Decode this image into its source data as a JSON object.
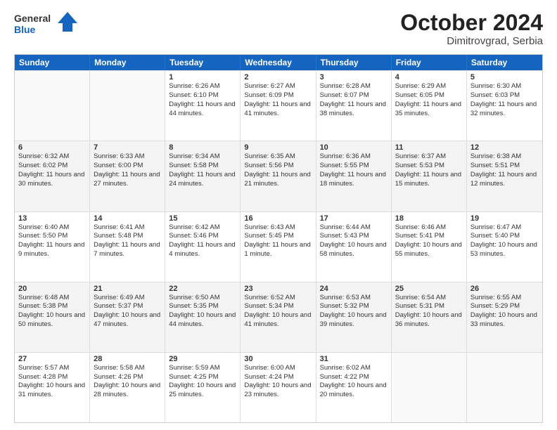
{
  "header": {
    "logo_general": "General",
    "logo_blue": "Blue",
    "month_year": "October 2024",
    "location": "Dimitrovgrad, Serbia"
  },
  "days_of_week": [
    "Sunday",
    "Monday",
    "Tuesday",
    "Wednesday",
    "Thursday",
    "Friday",
    "Saturday"
  ],
  "weeks": [
    [
      {
        "day": "",
        "sunrise": "",
        "sunset": "",
        "daylight": ""
      },
      {
        "day": "",
        "sunrise": "",
        "sunset": "",
        "daylight": ""
      },
      {
        "day": "1",
        "sunrise": "Sunrise: 6:26 AM",
        "sunset": "Sunset: 6:10 PM",
        "daylight": "Daylight: 11 hours and 44 minutes."
      },
      {
        "day": "2",
        "sunrise": "Sunrise: 6:27 AM",
        "sunset": "Sunset: 6:09 PM",
        "daylight": "Daylight: 11 hours and 41 minutes."
      },
      {
        "day": "3",
        "sunrise": "Sunrise: 6:28 AM",
        "sunset": "Sunset: 6:07 PM",
        "daylight": "Daylight: 11 hours and 38 minutes."
      },
      {
        "day": "4",
        "sunrise": "Sunrise: 6:29 AM",
        "sunset": "Sunset: 6:05 PM",
        "daylight": "Daylight: 11 hours and 35 minutes."
      },
      {
        "day": "5",
        "sunrise": "Sunrise: 6:30 AM",
        "sunset": "Sunset: 6:03 PM",
        "daylight": "Daylight: 11 hours and 32 minutes."
      }
    ],
    [
      {
        "day": "6",
        "sunrise": "Sunrise: 6:32 AM",
        "sunset": "Sunset: 6:02 PM",
        "daylight": "Daylight: 11 hours and 30 minutes."
      },
      {
        "day": "7",
        "sunrise": "Sunrise: 6:33 AM",
        "sunset": "Sunset: 6:00 PM",
        "daylight": "Daylight: 11 hours and 27 minutes."
      },
      {
        "day": "8",
        "sunrise": "Sunrise: 6:34 AM",
        "sunset": "Sunset: 5:58 PM",
        "daylight": "Daylight: 11 hours and 24 minutes."
      },
      {
        "day": "9",
        "sunrise": "Sunrise: 6:35 AM",
        "sunset": "Sunset: 5:56 PM",
        "daylight": "Daylight: 11 hours and 21 minutes."
      },
      {
        "day": "10",
        "sunrise": "Sunrise: 6:36 AM",
        "sunset": "Sunset: 5:55 PM",
        "daylight": "Daylight: 11 hours and 18 minutes."
      },
      {
        "day": "11",
        "sunrise": "Sunrise: 6:37 AM",
        "sunset": "Sunset: 5:53 PM",
        "daylight": "Daylight: 11 hours and 15 minutes."
      },
      {
        "day": "12",
        "sunrise": "Sunrise: 6:38 AM",
        "sunset": "Sunset: 5:51 PM",
        "daylight": "Daylight: 11 hours and 12 minutes."
      }
    ],
    [
      {
        "day": "13",
        "sunrise": "Sunrise: 6:40 AM",
        "sunset": "Sunset: 5:50 PM",
        "daylight": "Daylight: 11 hours and 9 minutes."
      },
      {
        "day": "14",
        "sunrise": "Sunrise: 6:41 AM",
        "sunset": "Sunset: 5:48 PM",
        "daylight": "Daylight: 11 hours and 7 minutes."
      },
      {
        "day": "15",
        "sunrise": "Sunrise: 6:42 AM",
        "sunset": "Sunset: 5:46 PM",
        "daylight": "Daylight: 11 hours and 4 minutes."
      },
      {
        "day": "16",
        "sunrise": "Sunrise: 6:43 AM",
        "sunset": "Sunset: 5:45 PM",
        "daylight": "Daylight: 11 hours and 1 minute."
      },
      {
        "day": "17",
        "sunrise": "Sunrise: 6:44 AM",
        "sunset": "Sunset: 5:43 PM",
        "daylight": "Daylight: 10 hours and 58 minutes."
      },
      {
        "day": "18",
        "sunrise": "Sunrise: 6:46 AM",
        "sunset": "Sunset: 5:41 PM",
        "daylight": "Daylight: 10 hours and 55 minutes."
      },
      {
        "day": "19",
        "sunrise": "Sunrise: 6:47 AM",
        "sunset": "Sunset: 5:40 PM",
        "daylight": "Daylight: 10 hours and 53 minutes."
      }
    ],
    [
      {
        "day": "20",
        "sunrise": "Sunrise: 6:48 AM",
        "sunset": "Sunset: 5:38 PM",
        "daylight": "Daylight: 10 hours and 50 minutes."
      },
      {
        "day": "21",
        "sunrise": "Sunrise: 6:49 AM",
        "sunset": "Sunset: 5:37 PM",
        "daylight": "Daylight: 10 hours and 47 minutes."
      },
      {
        "day": "22",
        "sunrise": "Sunrise: 6:50 AM",
        "sunset": "Sunset: 5:35 PM",
        "daylight": "Daylight: 10 hours and 44 minutes."
      },
      {
        "day": "23",
        "sunrise": "Sunrise: 6:52 AM",
        "sunset": "Sunset: 5:34 PM",
        "daylight": "Daylight: 10 hours and 41 minutes."
      },
      {
        "day": "24",
        "sunrise": "Sunrise: 6:53 AM",
        "sunset": "Sunset: 5:32 PM",
        "daylight": "Daylight: 10 hours and 39 minutes."
      },
      {
        "day": "25",
        "sunrise": "Sunrise: 6:54 AM",
        "sunset": "Sunset: 5:31 PM",
        "daylight": "Daylight: 10 hours and 36 minutes."
      },
      {
        "day": "26",
        "sunrise": "Sunrise: 6:55 AM",
        "sunset": "Sunset: 5:29 PM",
        "daylight": "Daylight: 10 hours and 33 minutes."
      }
    ],
    [
      {
        "day": "27",
        "sunrise": "Sunrise: 5:57 AM",
        "sunset": "Sunset: 4:28 PM",
        "daylight": "Daylight: 10 hours and 31 minutes."
      },
      {
        "day": "28",
        "sunrise": "Sunrise: 5:58 AM",
        "sunset": "Sunset: 4:26 PM",
        "daylight": "Daylight: 10 hours and 28 minutes."
      },
      {
        "day": "29",
        "sunrise": "Sunrise: 5:59 AM",
        "sunset": "Sunset: 4:25 PM",
        "daylight": "Daylight: 10 hours and 25 minutes."
      },
      {
        "day": "30",
        "sunrise": "Sunrise: 6:00 AM",
        "sunset": "Sunset: 4:24 PM",
        "daylight": "Daylight: 10 hours and 23 minutes."
      },
      {
        "day": "31",
        "sunrise": "Sunrise: 6:02 AM",
        "sunset": "Sunset: 4:22 PM",
        "daylight": "Daylight: 10 hours and 20 minutes."
      },
      {
        "day": "",
        "sunrise": "",
        "sunset": "",
        "daylight": ""
      },
      {
        "day": "",
        "sunrise": "",
        "sunset": "",
        "daylight": ""
      }
    ]
  ]
}
